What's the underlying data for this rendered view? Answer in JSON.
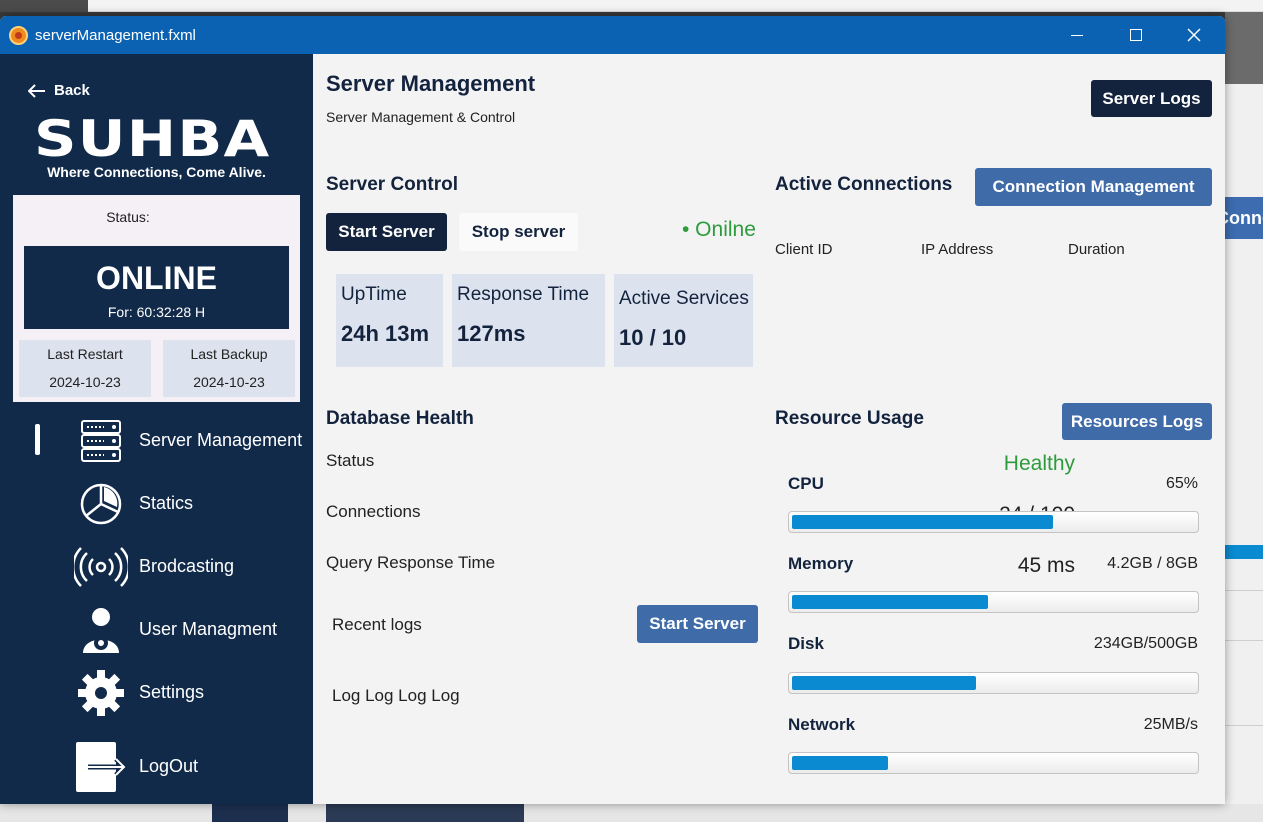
{
  "window": {
    "title": "serverManagement.fxml"
  },
  "sidebar": {
    "back_label": "Back",
    "logo": "SUHBA",
    "tagline": "Where Connections, Come Alive.",
    "status_card": {
      "label": "Status:",
      "state": "ONLINE",
      "for": "For: 60:32:28 H",
      "last_restart_label": "Last Restart",
      "last_restart_value": "2024-10-23",
      "last_backup_label": "Last Backup",
      "last_backup_value": "2024-10-23"
    },
    "nav": [
      {
        "label": "Server Management",
        "icon": "server-rack-icon",
        "active": true
      },
      {
        "label": "Statics",
        "icon": "pie-chart-icon"
      },
      {
        "label": "Brodcasting",
        "icon": "broadcast-icon"
      },
      {
        "label": "User Managment",
        "icon": "user-gear-icon"
      },
      {
        "label": "Settings",
        "icon": "gear-icon"
      },
      {
        "label": "LogOut",
        "icon": "logout-icon"
      }
    ]
  },
  "main": {
    "title": "Server Management",
    "subtitle": "Server Management & Control",
    "server_logs_button": "Server Logs",
    "server_control": {
      "heading": "Server Control",
      "start_button": "Start Server",
      "stop_button": "Stop server",
      "status": "• Onilne",
      "stats": [
        {
          "label": "UpTime",
          "value": "24h 13m"
        },
        {
          "label": "Response Time",
          "value": "127ms"
        },
        {
          "label": "Active Services",
          "value": "10 / 10"
        }
      ]
    },
    "active_connections": {
      "heading": "Active Connections",
      "button": "Connection Management",
      "columns": [
        "Client ID",
        "IP Address",
        "Duration"
      ]
    },
    "database_health": {
      "heading": "Database Health",
      "rows": [
        {
          "label": "Status",
          "value": "Healthy"
        },
        {
          "label": "Connections",
          "value": "24 / 100"
        },
        {
          "label": "Query Response Time",
          "value": "45 ms"
        }
      ],
      "recent_logs_label": "Recent logs",
      "recent_logs_button": "Start Server",
      "log_text": "Log Log Log Log"
    },
    "resource_usage": {
      "heading": "Resource Usage",
      "button": "Resources Logs",
      "items": [
        {
          "label": "CPU",
          "value": "65%",
          "fill": 0.65
        },
        {
          "label": "Memory",
          "value": "4.2GB / 8GB",
          "fill": 0.49
        },
        {
          "label": "Disk",
          "value": "234GB/500GB",
          "fill": 0.46
        },
        {
          "label": "Network",
          "value": "25MB/s",
          "fill": 0.24
        }
      ]
    }
  },
  "colors": {
    "navy": "#13233d",
    "sidebar": "#112a4a",
    "accent_blue": "#3f6ba9",
    "bar_fill": "#0a8ad0",
    "healthy_green": "#2e9b3c",
    "titlebar": "#0b62b3"
  },
  "background": {
    "partial_button": "Connect"
  }
}
